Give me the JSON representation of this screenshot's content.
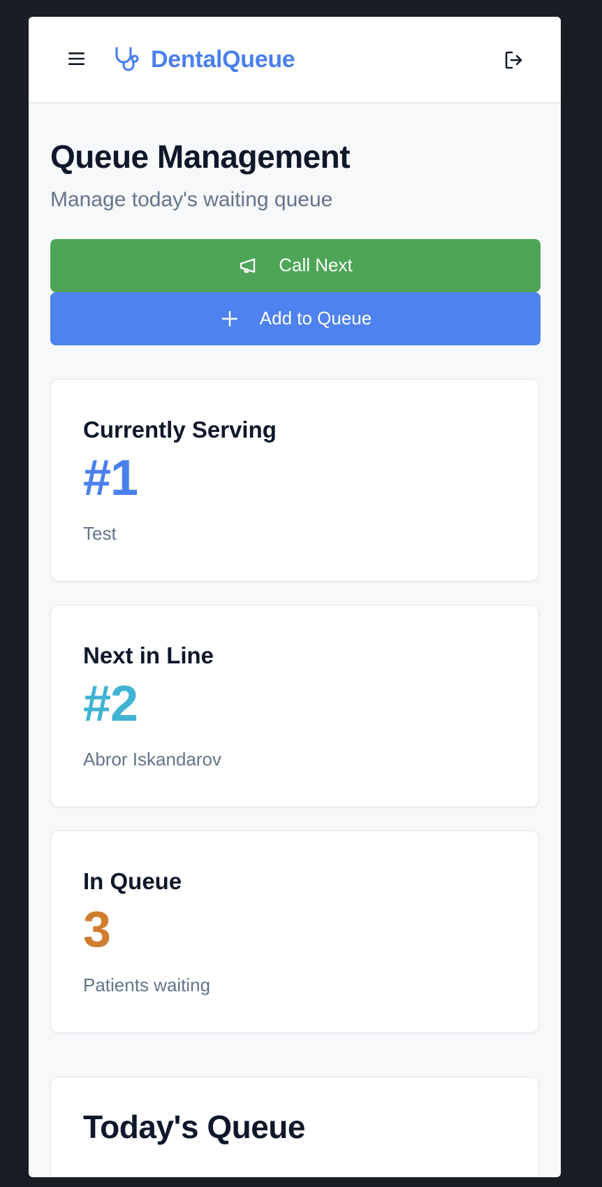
{
  "app": {
    "brand_name": "DentalQueue",
    "brand_color": "#4a80ee",
    "icons": {
      "menu": "hamburger-menu-icon",
      "brand": "stethoscope-icon",
      "logout": "logout-icon"
    }
  },
  "page": {
    "title": "Queue Management",
    "subtitle": "Manage today's waiting queue"
  },
  "actions": {
    "call_next": {
      "label": "Call Next",
      "icon": "megaphone-icon",
      "color": "#4ea557"
    },
    "add_to_queue": {
      "label": "Add to Queue",
      "icon": "plus-icon",
      "color": "#4e82ee"
    }
  },
  "stats": {
    "currently_serving": {
      "title": "Currently Serving",
      "value": "#1",
      "subtitle": "Test",
      "color": "#4a80ee"
    },
    "next_in_line": {
      "title": "Next in Line",
      "value": "#2",
      "subtitle": "Abror Iskandarov",
      "color": "#41b3d2"
    },
    "in_queue": {
      "title": "In Queue",
      "value": "3",
      "subtitle": "Patients waiting",
      "color": "#d17d30"
    }
  },
  "today_queue": {
    "title": "Today's Queue"
  }
}
